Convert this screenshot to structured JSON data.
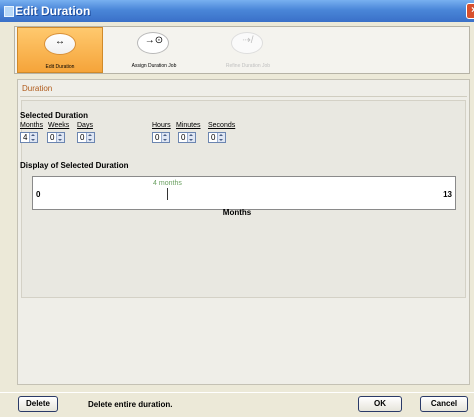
{
  "window": {
    "title": "Edit Duration",
    "close_icon": "×"
  },
  "toolbar": {
    "items": [
      {
        "label": "Edit Duration",
        "icon": "↔",
        "state": "active"
      },
      {
        "label": "Assign Duration Job",
        "icon": "→⊙",
        "state": "normal"
      },
      {
        "label": "Refine Duration Job",
        "icon": "⇢/",
        "state": "disabled"
      }
    ]
  },
  "duration": {
    "section_title": "Duration",
    "selected_heading": "Selected Duration",
    "fields": [
      {
        "label": "Months",
        "value": "4"
      },
      {
        "label": "Weeks",
        "value": "0"
      },
      {
        "label": "Days",
        "value": "0"
      },
      {
        "label": "Hours",
        "value": "0"
      },
      {
        "label": "Minutes",
        "value": "0"
      },
      {
        "label": "Seconds",
        "value": "0"
      }
    ],
    "display_heading": "Display of Selected Duration",
    "scale": {
      "min": "0",
      "max": "13",
      "marker_label": "4 months",
      "marker_value": 4,
      "unit_label": "Months"
    }
  },
  "footer": {
    "delete_label": "Delete",
    "hint": "Delete entire duration.",
    "ok_label": "OK",
    "cancel_label": "Cancel"
  },
  "colors": {
    "title_bar": "#3a70c8",
    "active_tool": "#f5a43a",
    "section_title": "#b05a1a",
    "marker_label": "#6aa060"
  }
}
